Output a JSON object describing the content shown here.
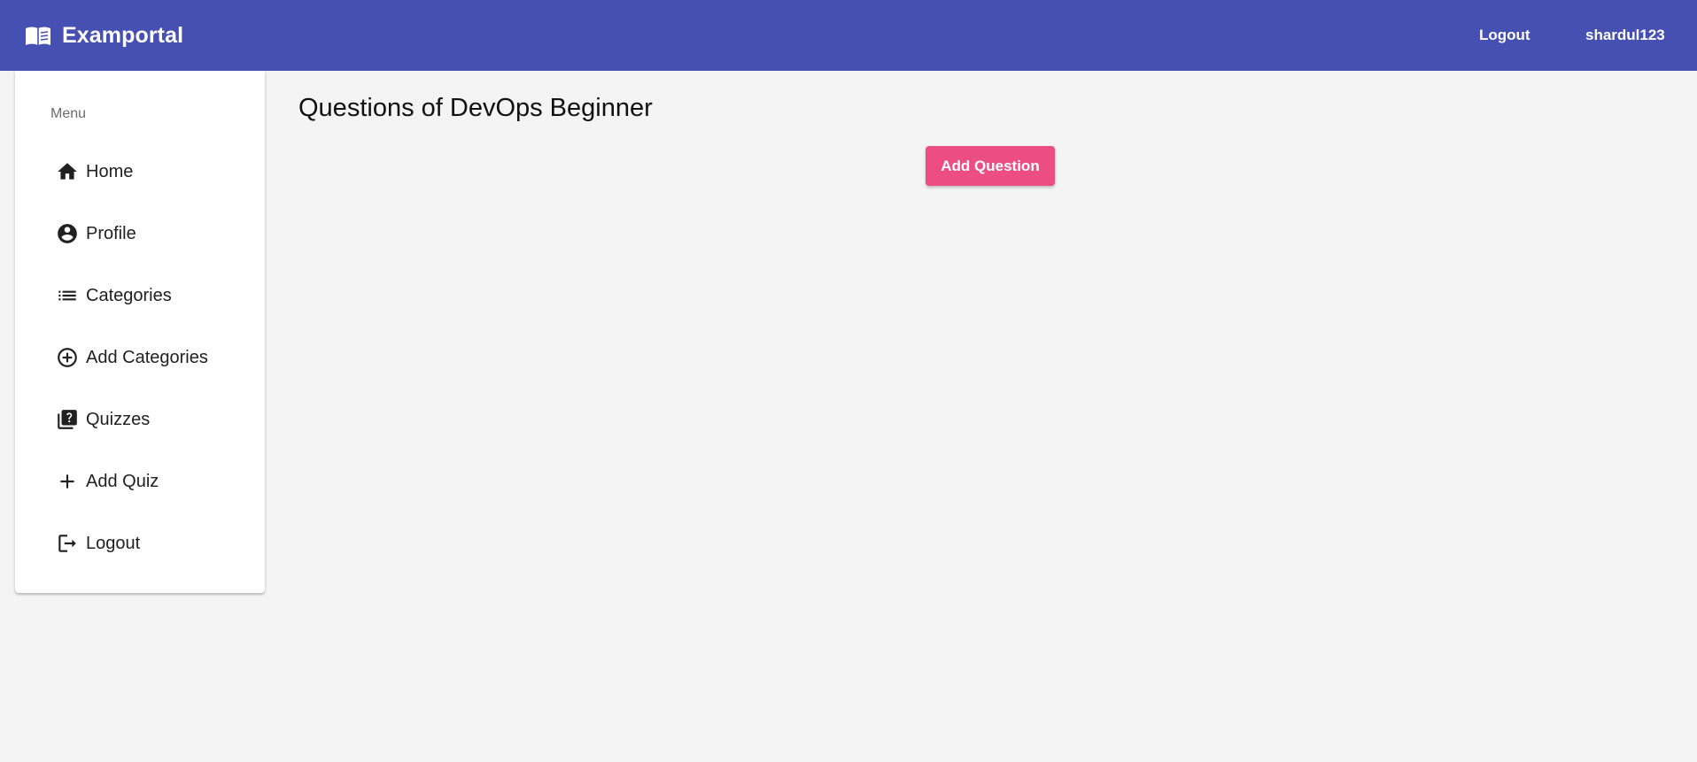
{
  "header": {
    "brand_icon": "open-book-icon",
    "title": "Examportal",
    "logout_label": "Logout",
    "username": "shardul123",
    "color": "#4550b2"
  },
  "sidebar": {
    "menu_label": "Menu",
    "items": [
      {
        "label": "Home",
        "icon": "home-icon"
      },
      {
        "label": "Profile",
        "icon": "account-circle-icon"
      },
      {
        "label": "Categories",
        "icon": "list-icon"
      },
      {
        "label": "Add Categories",
        "icon": "add-circle-outline-icon"
      },
      {
        "label": "Quizzes",
        "icon": "quiz-icon"
      },
      {
        "label": "Add Quiz",
        "icon": "add-icon"
      },
      {
        "label": "Logout",
        "icon": "logout-icon"
      }
    ]
  },
  "main": {
    "title": "Questions of DevOps Beginner",
    "add_button_label": "Add Question",
    "accent_color": "#ec4d82"
  }
}
